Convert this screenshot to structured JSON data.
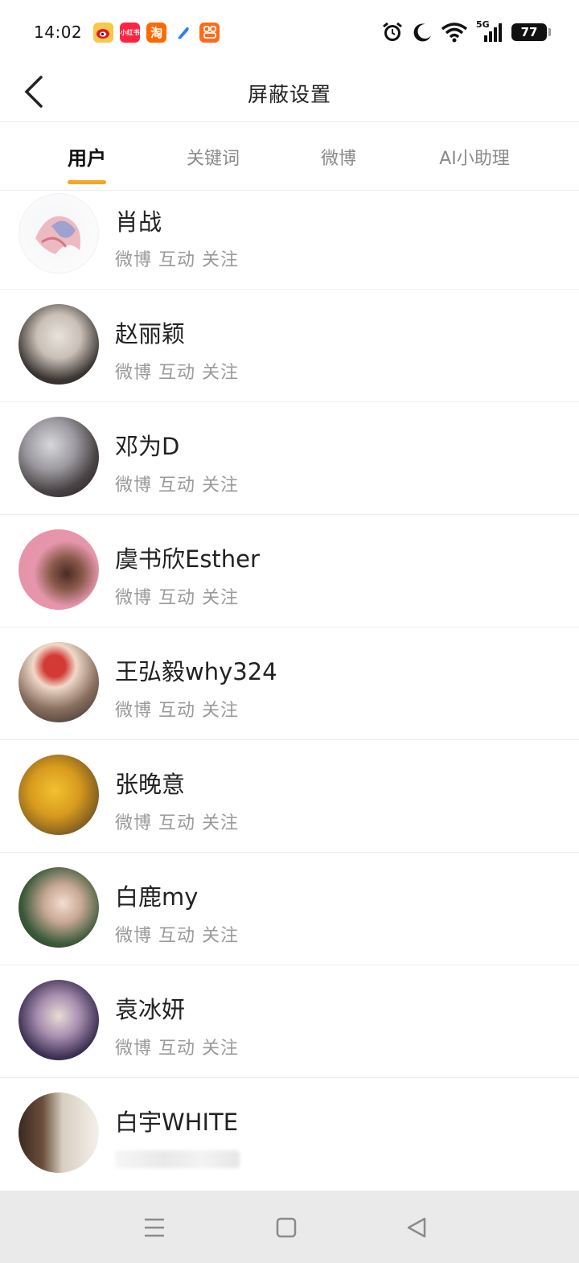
{
  "status_bar": {
    "time": "14:02",
    "battery": "77",
    "network": "5G",
    "app_icons": [
      {
        "name": "weibo-app-icon",
        "color": "#f7c948",
        "label": ""
      },
      {
        "name": "xiaohongshu-app-icon",
        "color": "#ff2442",
        "label": "小红书"
      },
      {
        "name": "taobao-app-icon",
        "color": "#ff6a00",
        "label": "淘"
      },
      {
        "name": "blue-app-icon",
        "color": "#2f7df6",
        "label": ""
      },
      {
        "name": "orange-app-icon",
        "color": "#ff6a1a",
        "label": ""
      }
    ]
  },
  "header": {
    "title": "屏蔽设置"
  },
  "tabs": [
    {
      "label": "用户",
      "active": true
    },
    {
      "label": "关键词",
      "active": false
    },
    {
      "label": "微博",
      "active": false
    },
    {
      "label": "AI小助理",
      "active": false
    }
  ],
  "accent_color": "#f5a623",
  "users": [
    {
      "name": "肖战",
      "sub": "微博 互动 关注"
    },
    {
      "name": "赵丽颖",
      "sub": "微博 互动 关注"
    },
    {
      "name": "邓为D",
      "sub": "微博 互动 关注"
    },
    {
      "name": "虞书欣Esther",
      "sub": "微博 互动 关注"
    },
    {
      "name": "王弘毅why324",
      "sub": "微博 互动 关注"
    },
    {
      "name": "张晚意",
      "sub": "微博 互动 关注"
    },
    {
      "name": "白鹿my",
      "sub": "微博 互动 关注"
    },
    {
      "name": "袁冰妍",
      "sub": "微博 互动 关注"
    },
    {
      "name": "白宇WHITE",
      "sub": ""
    }
  ]
}
